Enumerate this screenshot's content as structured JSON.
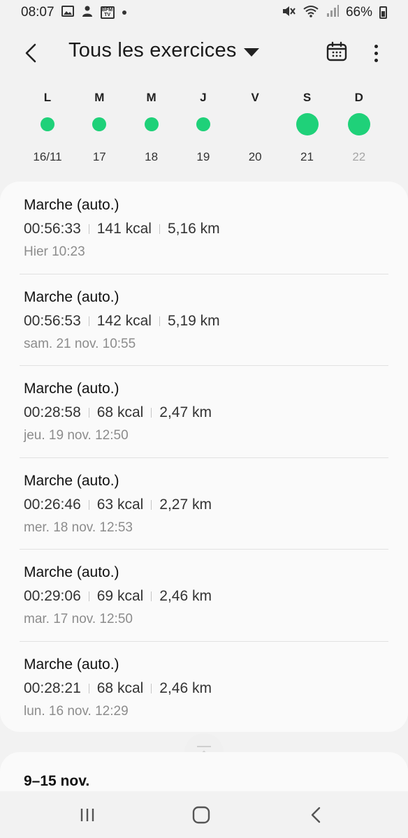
{
  "status_bar": {
    "time": "08:07",
    "left_icons": [
      "image-icon",
      "person-icon",
      "bfm-tv-icon",
      "dot-icon"
    ],
    "right_icons": [
      "mute-icon",
      "wifi-icon",
      "signal-icon"
    ],
    "battery": "66%",
    "bfm_text": "BFM TV"
  },
  "app_bar": {
    "title": "Tous les exercices",
    "icons": [
      "back-icon",
      "caret-down-icon",
      "calendar-icon",
      "more-vert-icon"
    ]
  },
  "week": {
    "days": [
      {
        "letter": "L",
        "date": "16/11",
        "activity": "small",
        "future": false
      },
      {
        "letter": "M",
        "date": "17",
        "activity": "small",
        "future": false
      },
      {
        "letter": "M",
        "date": "18",
        "activity": "small",
        "future": false
      },
      {
        "letter": "J",
        "date": "19",
        "activity": "small",
        "future": false
      },
      {
        "letter": "V",
        "date": "20",
        "activity": "none",
        "future": false
      },
      {
        "letter": "S",
        "date": "21",
        "activity": "big",
        "future": false
      },
      {
        "letter": "D",
        "date": "22",
        "activity": "big",
        "future": true
      }
    ],
    "dot_color": "#1fd179"
  },
  "exercises": [
    {
      "title": "Marche (auto.)",
      "duration": "00:56:33",
      "calories": "141 kcal",
      "distance": "5,16 km",
      "date": "Hier 10:23"
    },
    {
      "title": "Marche (auto.)",
      "duration": "00:56:53",
      "calories": "142 kcal",
      "distance": "5,19 km",
      "date": "sam. 21 nov. 10:55"
    },
    {
      "title": "Marche (auto.)",
      "duration": "00:28:58",
      "calories": "68 kcal",
      "distance": "2,47 km",
      "date": "jeu. 19 nov. 12:50"
    },
    {
      "title": "Marche (auto.)",
      "duration": "00:26:46",
      "calories": "63 kcal",
      "distance": "2,27 km",
      "date": "mer. 18 nov. 12:53"
    },
    {
      "title": "Marche (auto.)",
      "duration": "00:29:06",
      "calories": "69 kcal",
      "distance": "2,46 km",
      "date": "mar. 17 nov. 12:50"
    },
    {
      "title": "Marche (auto.)",
      "duration": "00:28:21",
      "calories": "68 kcal",
      "distance": "2,46 km",
      "date": "lun. 16 nov. 12:29"
    }
  ],
  "next_section": {
    "label": "9–15 nov."
  },
  "nav_bar": {
    "icons": [
      "recent-apps-icon",
      "home-icon",
      "back-nav-icon"
    ]
  }
}
